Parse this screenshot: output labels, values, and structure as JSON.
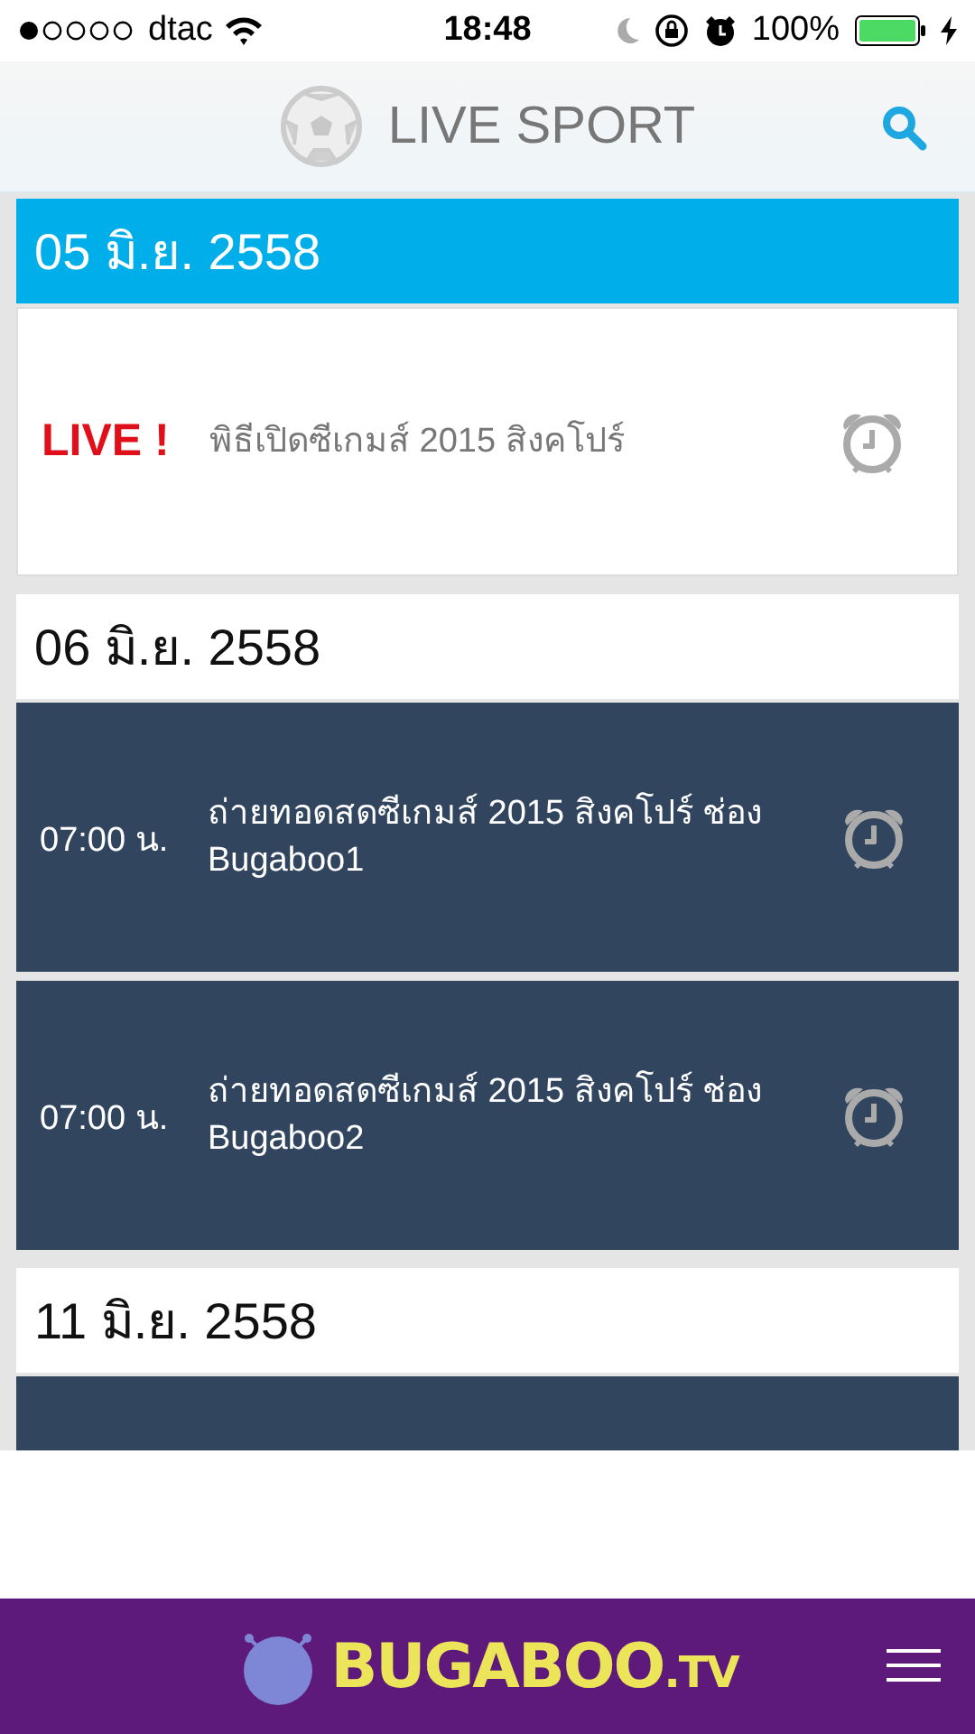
{
  "status_bar": {
    "carrier": "dtac",
    "time": "18:48",
    "battery": "100%"
  },
  "header": {
    "title": "LIVE SPORT"
  },
  "days": [
    {
      "date": "05 มิ.ย. 2558",
      "selected": true,
      "events": [
        {
          "kind": "live",
          "badge": "LIVE !",
          "title": "พิธีเปิดซีเกมส์ 2015 สิงคโปร์"
        }
      ]
    },
    {
      "date": "06 มิ.ย. 2558",
      "selected": false,
      "events": [
        {
          "kind": "scheduled",
          "time": "07:00 น.",
          "title": "ถ่ายทอดสดซีเกมส์ 2015 สิงคโปร์ ช่อง Bugaboo1"
        },
        {
          "kind": "scheduled",
          "time": "07:00 น.",
          "title": "ถ่ายทอดสดซีเกมส์ 2015 สิงคโปร์ ช่อง Bugaboo2"
        }
      ]
    },
    {
      "date": "11 มิ.ย. 2558",
      "selected": false,
      "events": [
        {
          "kind": "blank"
        }
      ]
    }
  ],
  "footer": {
    "logo": "BUGABOO",
    "logo_suffix": ".TV"
  }
}
